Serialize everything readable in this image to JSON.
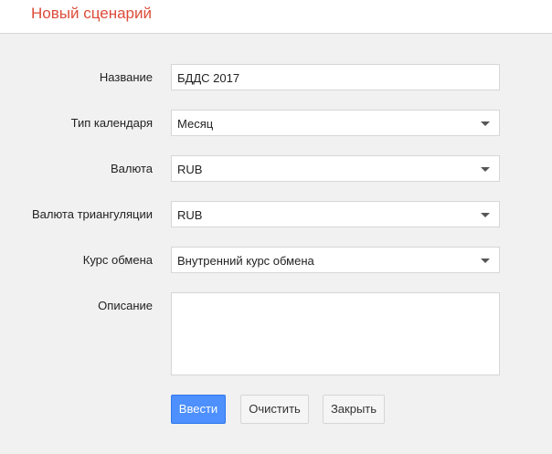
{
  "header": {
    "title": "Новый сценарий"
  },
  "form": {
    "name": {
      "label": "Название",
      "value": "БДДС 2017"
    },
    "calendar_type": {
      "label": "Тип календаря",
      "value": "Месяц"
    },
    "currency": {
      "label": "Валюта",
      "value": "RUB"
    },
    "triangulation_currency": {
      "label": "Валюта триангуляции",
      "value": "RUB"
    },
    "exchange_rate": {
      "label": "Курс обмена",
      "value": "Внутренний курс обмена"
    },
    "description": {
      "label": "Описание",
      "value": ""
    }
  },
  "buttons": {
    "submit": "Ввести",
    "clear": "Очистить",
    "close": "Закрыть"
  },
  "colors": {
    "title": "#dd4b39",
    "primary_button": "#4d90fe",
    "background": "#f1f1f1"
  },
  "icons": {
    "select_caret": "caret-down-icon"
  }
}
